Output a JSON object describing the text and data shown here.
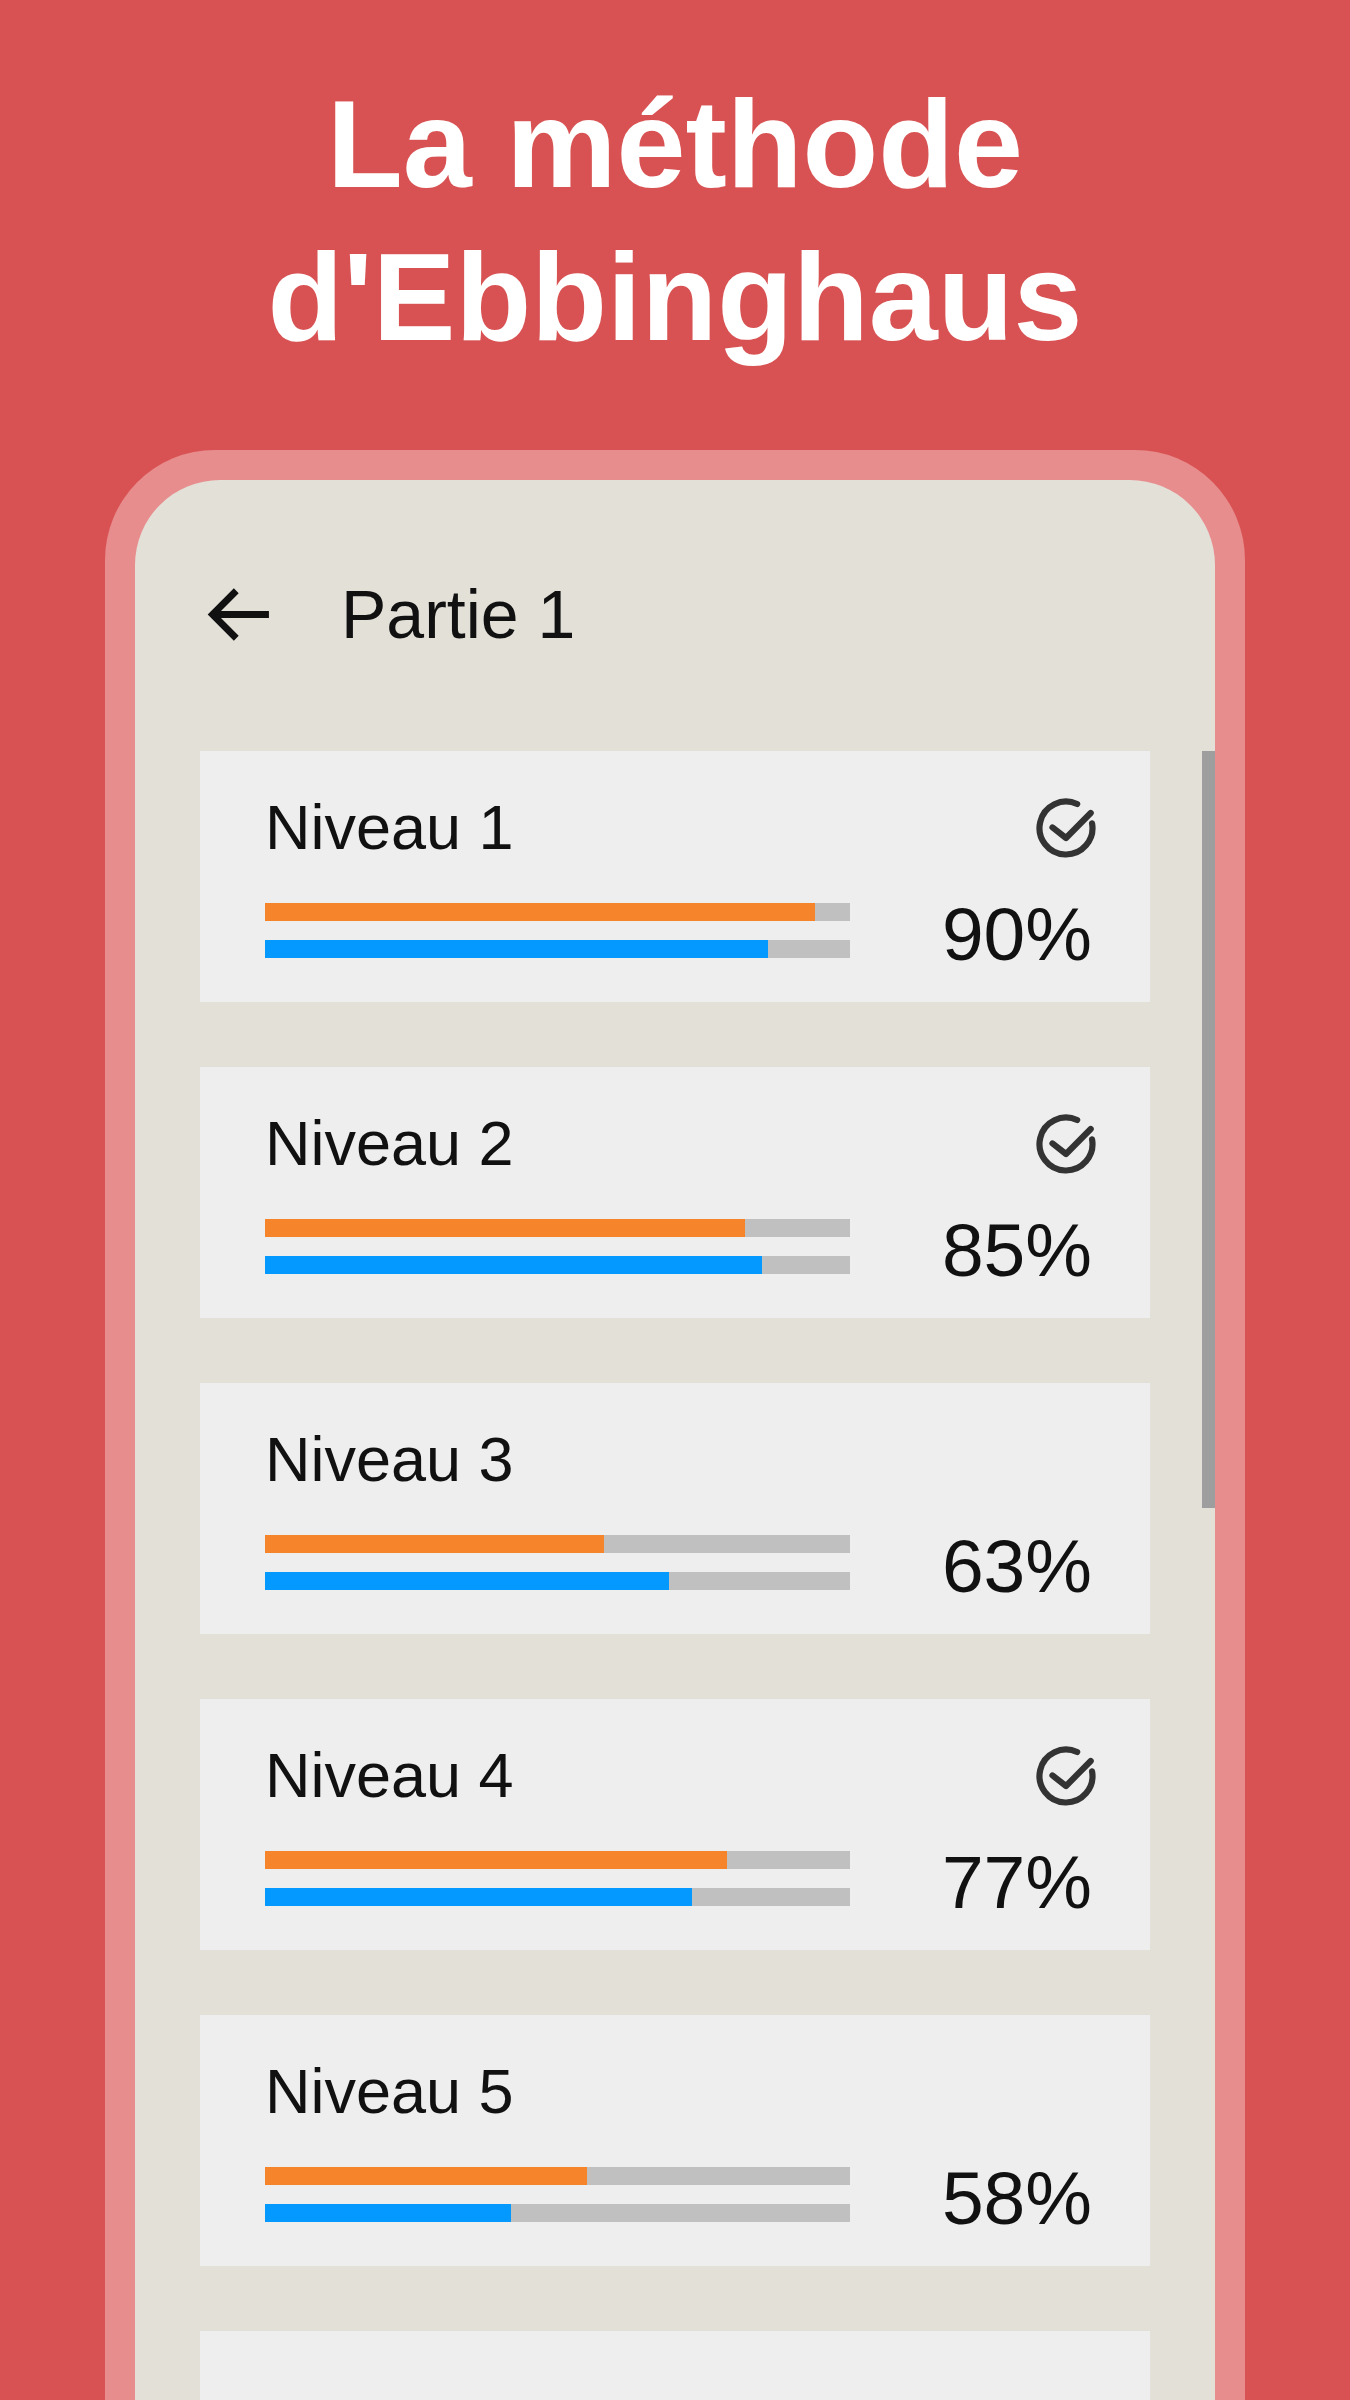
{
  "title": "La méthode d'Ebbinghaus",
  "header": {
    "title": "Partie 1"
  },
  "levels": [
    {
      "title": "Niveau 1",
      "completed": true,
      "progress": [
        {
          "color": "#f5842a",
          "level": 0.94
        },
        {
          "color": "#0399ff",
          "level": 0.86
        }
      ],
      "percent": "90%"
    },
    {
      "title": "Niveau 2",
      "completed": true,
      "progress": [
        {
          "color": "#f5842a",
          "level": 0.82
        },
        {
          "color": "#0399ff",
          "level": 0.85
        }
      ],
      "percent": "85%"
    },
    {
      "title": "Niveau 3",
      "completed": false,
      "progress": [
        {
          "color": "#f5842a",
          "level": 0.58
        },
        {
          "color": "#0399ff",
          "level": 0.69
        }
      ],
      "percent": "63%"
    },
    {
      "title": "Niveau 4",
      "completed": true,
      "progress": [
        {
          "color": "#f5842a",
          "level": 0.79
        },
        {
          "color": "#0399ff",
          "level": 0.73
        }
      ],
      "percent": "77%"
    },
    {
      "title": "Niveau 5",
      "completed": false,
      "progress": [
        {
          "color": "#f5842a",
          "level": 0.55
        },
        {
          "color": "#0399ff",
          "level": 0.42
        }
      ],
      "percent": "58%"
    },
    {
      "completed": false
    }
  ]
}
